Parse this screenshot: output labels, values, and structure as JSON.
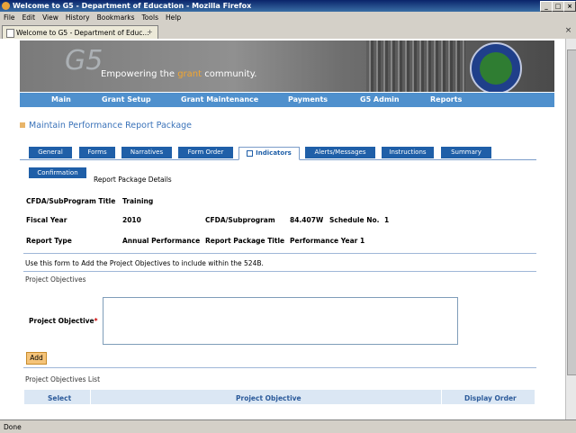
{
  "window": {
    "title": "Welcome to G5 - Department of Education - Mozilla Firefox",
    "min": "_",
    "max": "□",
    "close": "×"
  },
  "menu": [
    "File",
    "Edit",
    "View",
    "History",
    "Bookmarks",
    "Tools",
    "Help"
  ],
  "browser_tab": {
    "label": "Welcome to G5 - Department of Educ...",
    "close": "+",
    "new_tab": "×"
  },
  "status": "Done",
  "banner": {
    "logo": "G5",
    "tagline_pre": "Empowering the ",
    "tagline_accent": "grant",
    "tagline_post": " community."
  },
  "nav": [
    "Main",
    "Grant Setup",
    "Grant Maintenance",
    "Payments",
    "G5 Admin",
    "Reports"
  ],
  "page_title": "Maintain Performance Report Package",
  "tabs": [
    "General",
    "Forms",
    "Narratives",
    "Form Order",
    "Indicators",
    "Alerts/Messages",
    "Instructions",
    "Summary"
  ],
  "sub_tab": "Confirmation",
  "section_title": "Report Package Details",
  "details": {
    "cfda_title_label": "CFDA/SubProgram Title",
    "cfda_title_value": "Training",
    "fiscal_year_label": "Fiscal Year",
    "fiscal_year_value": "2010",
    "cfda_label": "CFDA/Subprogram",
    "cfda_value": "84.407W",
    "schedule_label": "Schedule No.",
    "schedule_value": "1",
    "report_type_label": "Report Type",
    "report_type_value": "Annual Performance",
    "package_title_label": "Report Package Title",
    "package_title_value": "Performance Year 1"
  },
  "instructions": "Use this form to Add the Project Objectives to include within the 524B.",
  "objectives": {
    "section": "Project Objectives",
    "field_label": "Project Objective",
    "required": "*",
    "value": "",
    "add": "Add"
  },
  "list": {
    "title": "Project Objectives List",
    "columns": [
      "Select",
      "Project Objective",
      "Display Order"
    ]
  }
}
